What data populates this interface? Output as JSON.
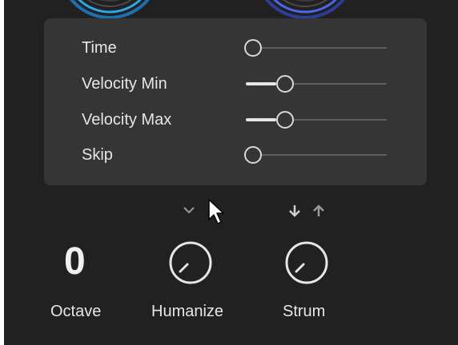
{
  "params": [
    {
      "label": "Time",
      "value": 0.0
    },
    {
      "label": "Velocity Min",
      "value": 0.25
    },
    {
      "label": "Velocity Max",
      "value": 0.25
    },
    {
      "label": "Skip",
      "value": 0.0
    }
  ],
  "octave": {
    "value": "0",
    "label": "Octave"
  },
  "humanize": {
    "label": "Humanize",
    "icon": "chevron-down-icon"
  },
  "strum": {
    "label": "Strum",
    "icons": [
      "arrow-down-icon",
      "arrow-up-icon"
    ]
  },
  "colors": {
    "background": "#212121",
    "panel": "#353535",
    "text": "#e6e6e6",
    "accent_cyan": "#2ba8e8",
    "accent_blue": "#4a67ee"
  }
}
